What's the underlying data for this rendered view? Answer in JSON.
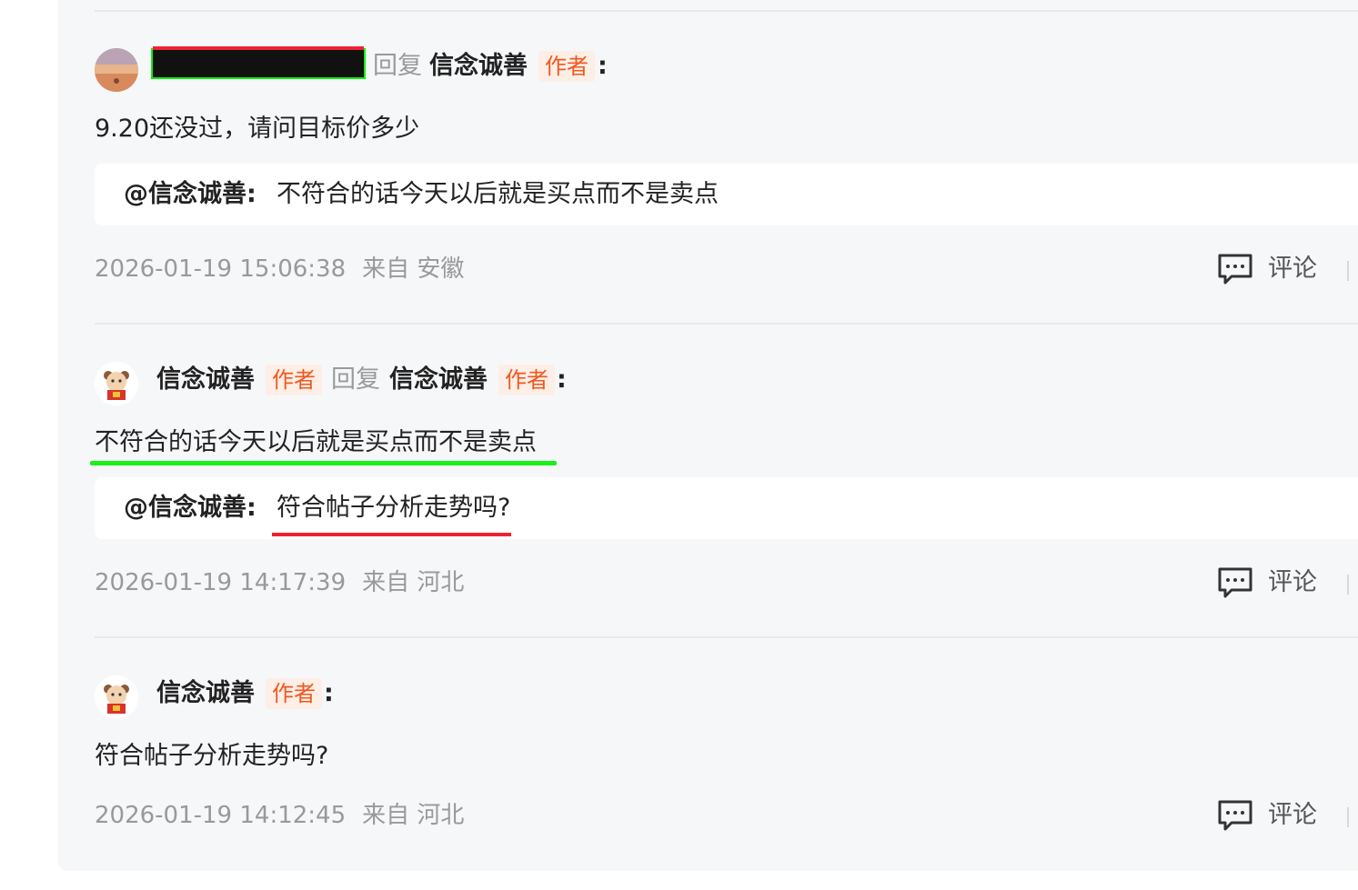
{
  "comments": [
    {
      "author": "",
      "reply_label": "回复",
      "reply_to": "信念诚善",
      "reply_to_badge": "作者",
      "colon": ":",
      "text": "9.20还没过，请问目标价多少",
      "quote": {
        "at": "@信念诚善:",
        "text": "不符合的话今天以后就是买点而不是卖点"
      },
      "time": "2026-01-19 15:06:38",
      "location": "来自 安徽",
      "comment_label": "评论"
    },
    {
      "author": "信念诚善",
      "author_badge": "作者",
      "reply_label": "回复",
      "reply_to": "信念诚善",
      "reply_to_badge": "作者",
      "colon": ":",
      "text": "不符合的话今天以后就是买点而不是卖点",
      "quote": {
        "at": "@信念诚善:",
        "text": "符合帖子分析走势吗?"
      },
      "time": "2026-01-19 14:17:39",
      "location": "来自 河北",
      "comment_label": "评论"
    },
    {
      "author": "信念诚善",
      "author_badge": "作者",
      "colon": ":",
      "text": "符合帖子分析走势吗?",
      "time": "2026-01-19 14:12:45",
      "location": "来自 河北",
      "comment_label": "评论"
    }
  ],
  "colors": {
    "badge_text": "#f0581f",
    "badge_bg": "#fdeee6",
    "highlight_green": "#1af01a",
    "highlight_red": "#ee2233"
  }
}
